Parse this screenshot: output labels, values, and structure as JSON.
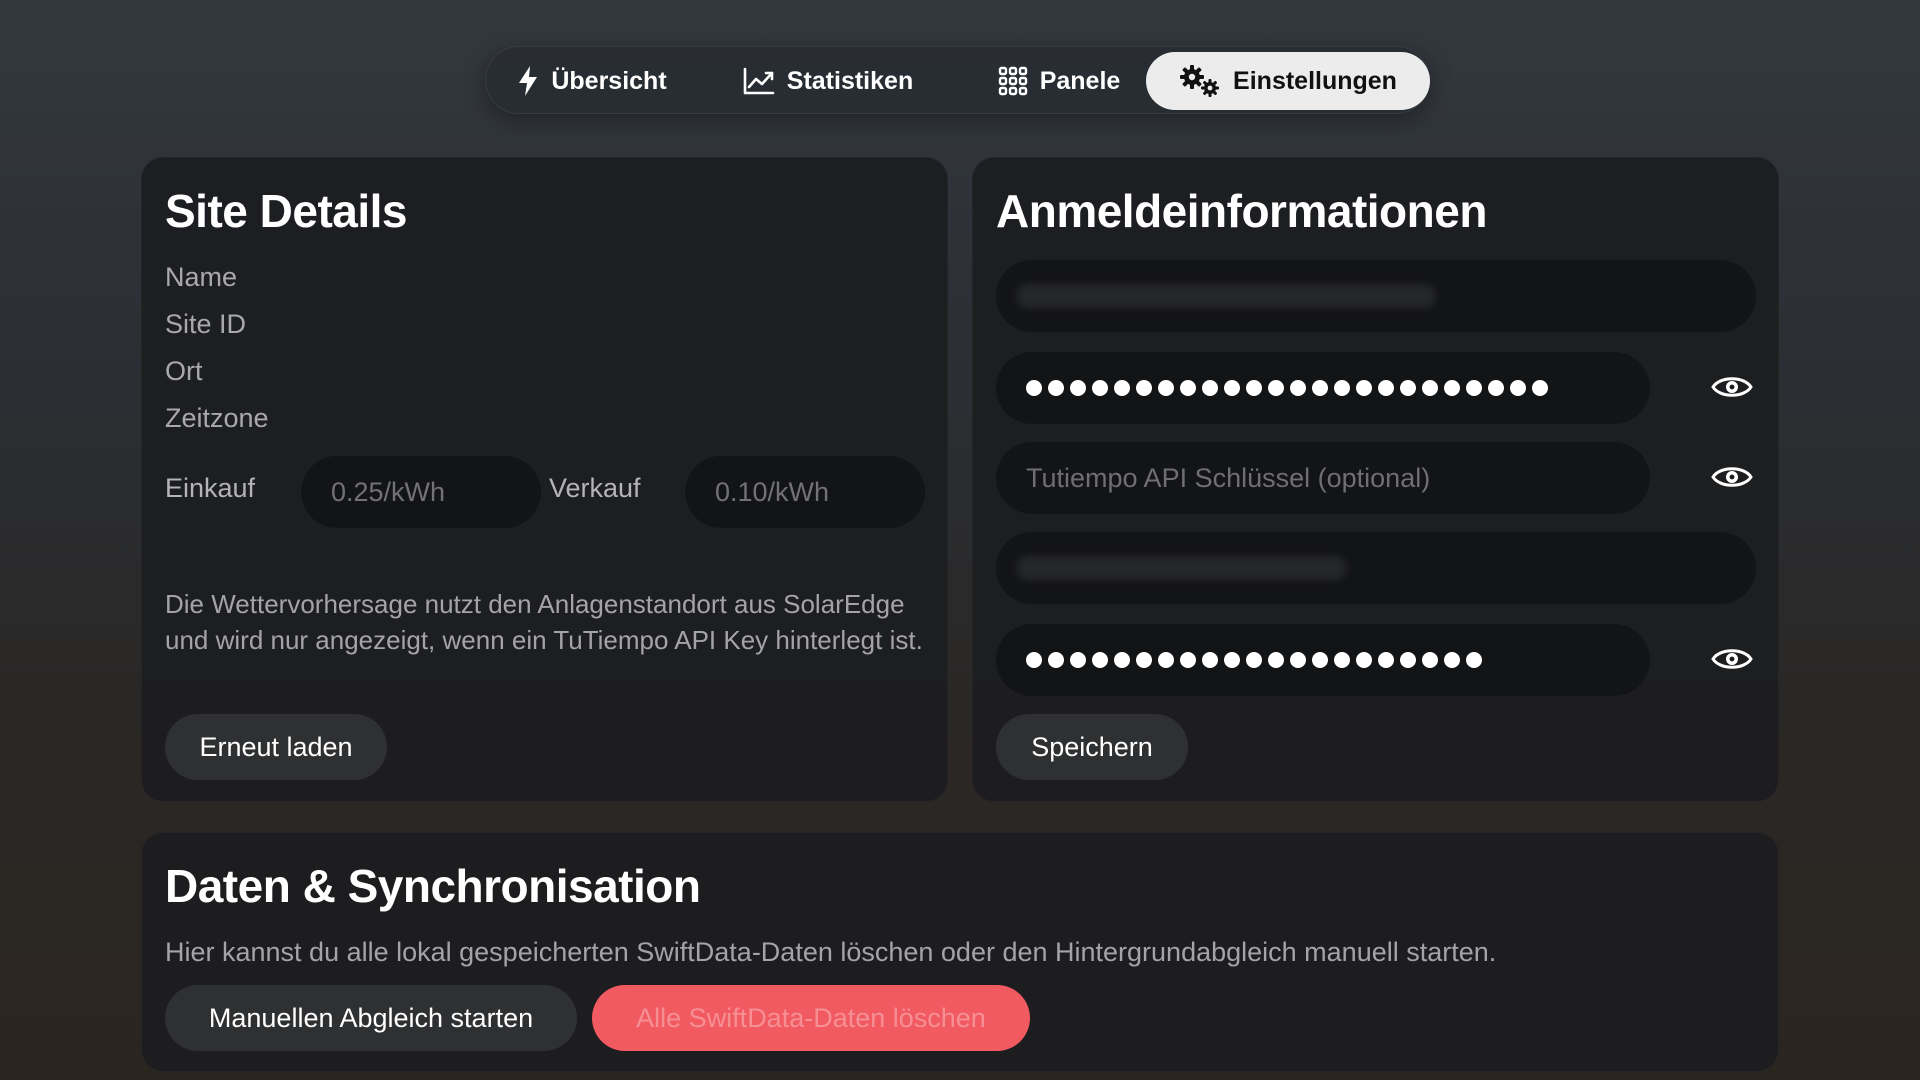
{
  "tabs": [
    {
      "label": "Übersicht",
      "icon": "bolt-icon",
      "active": false
    },
    {
      "label": "Statistiken",
      "icon": "chart-line-icon",
      "active": false
    },
    {
      "label": "Panele",
      "icon": "grid-icon",
      "active": false
    },
    {
      "label": "Einstellungen",
      "icon": "gears-icon",
      "active": true
    }
  ],
  "site_details": {
    "title": "Site Details",
    "labels": {
      "name": "Name",
      "site_id": "Site ID",
      "ort": "Ort",
      "zeitzone": "Zeitzone"
    },
    "purchase_label": "Einkauf",
    "purchase_placeholder": "0.25/kWh",
    "sale_label": "Verkauf",
    "sale_placeholder": "0.10/kWh",
    "info": "Die Wettervorhersage nutzt den Anlagenstandort aus SolarEdge und wird nur angezeigt, wenn ein TuTiempo API Key hinterlegt ist.",
    "reload_button": "Erneut laden"
  },
  "credentials": {
    "title": "Anmeldeinformationen",
    "api_key_dots": 24,
    "tutiempo_placeholder": "Tutiempo API Schlüssel (optional)",
    "password_dots": 21,
    "save_button": "Speichern"
  },
  "data_sync": {
    "title": "Daten & Synchronisation",
    "description": "Hier kannst du alle lokal gespeicherten SwiftData-Daten löschen oder den Hintergrundabgleich manuell starten.",
    "manual_sync_button": "Manuellen Abgleich starten",
    "delete_button": "Alle SwiftData-Daten löschen"
  },
  "colors": {
    "accent_danger": "#f25a62",
    "card_bg": "#1c1d1f",
    "field_bg": "#131416",
    "active_tab_bg": "#ececec"
  }
}
